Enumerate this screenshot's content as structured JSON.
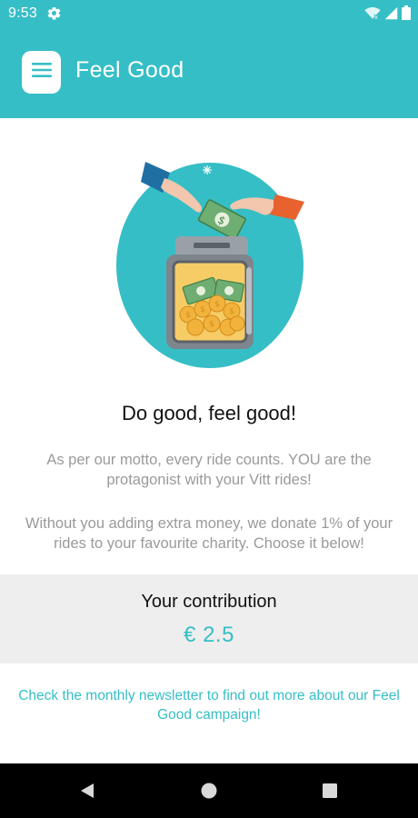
{
  "status": {
    "time": "9:53",
    "icons": [
      "gear-icon",
      "wifi-icon",
      "signal-icon",
      "battery-icon"
    ]
  },
  "appbar": {
    "title": "Feel Good",
    "menu_icon": "hamburger-menu-icon"
  },
  "illustration": {
    "name": "donation-jar-illustration",
    "colors": {
      "circle": "#36bec6",
      "jar": "#8a8f96",
      "coins": "#f2b33d",
      "bills": "#5aa66b"
    }
  },
  "content": {
    "headline": "Do good, feel good!",
    "paragraph1": "As per our motto, every ride counts. YOU are the protagonist with your Vitt rides!",
    "paragraph2": "Without you adding extra money, we donate 1% of your rides to your favourite charity. Choose it below!"
  },
  "contribution": {
    "label": "Your contribution",
    "value": "€ 2.5"
  },
  "newsletter": {
    "text": "Check the monthly newsletter to find out more about our Feel Good campaign!"
  },
  "navbar": {
    "buttons": [
      "back-icon",
      "home-icon",
      "recents-icon"
    ]
  },
  "colors": {
    "accent": "#36bec6",
    "contribution_bg": "#eeeeee"
  }
}
